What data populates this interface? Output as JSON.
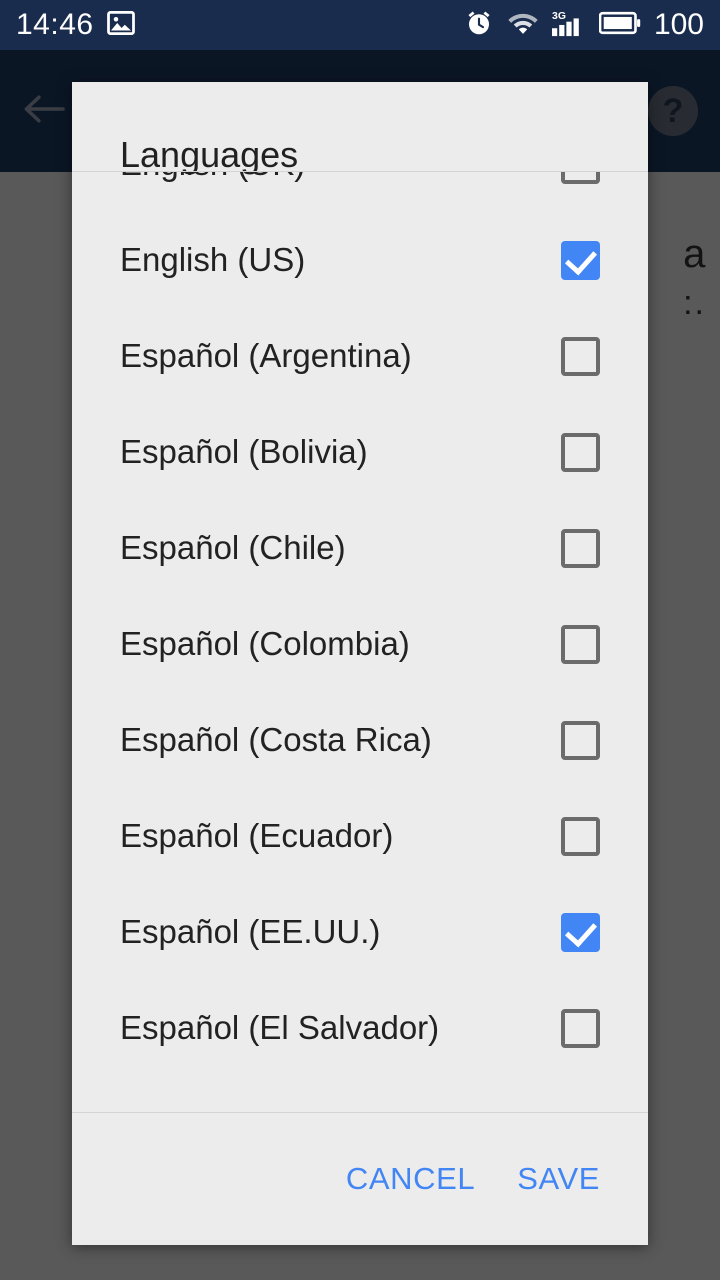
{
  "status_bar": {
    "clock": "14:46",
    "battery_level": "100",
    "icons": [
      "image-icon",
      "alarm-icon",
      "wifi-icon",
      "signal-3g-icon",
      "battery-icon"
    ],
    "background_color": "#1a2c4e",
    "foreground_color": "#ffffff"
  },
  "app_bar": {
    "back_icon": "back-arrow-icon",
    "help_label": "?",
    "background_color": "#1e3a63"
  },
  "background_content": {
    "line1": "a",
    "line2": ":."
  },
  "dialog": {
    "title": "Languages",
    "background_color": "#ececec",
    "accent_color": "#4285f4",
    "languages": [
      {
        "label": "English (UK)",
        "checked": false
      },
      {
        "label": "English (US)",
        "checked": true
      },
      {
        "label": "Español (Argentina)",
        "checked": false
      },
      {
        "label": "Español (Bolivia)",
        "checked": false
      },
      {
        "label": "Español (Chile)",
        "checked": false
      },
      {
        "label": "Español (Colombia)",
        "checked": false
      },
      {
        "label": "Español (Costa Rica)",
        "checked": false
      },
      {
        "label": "Español (Ecuador)",
        "checked": false
      },
      {
        "label": "Español (EE.UU.)",
        "checked": true
      },
      {
        "label": "Español (El Salvador)",
        "checked": false
      }
    ],
    "actions": {
      "cancel_label": "CANCEL",
      "save_label": "SAVE"
    }
  }
}
